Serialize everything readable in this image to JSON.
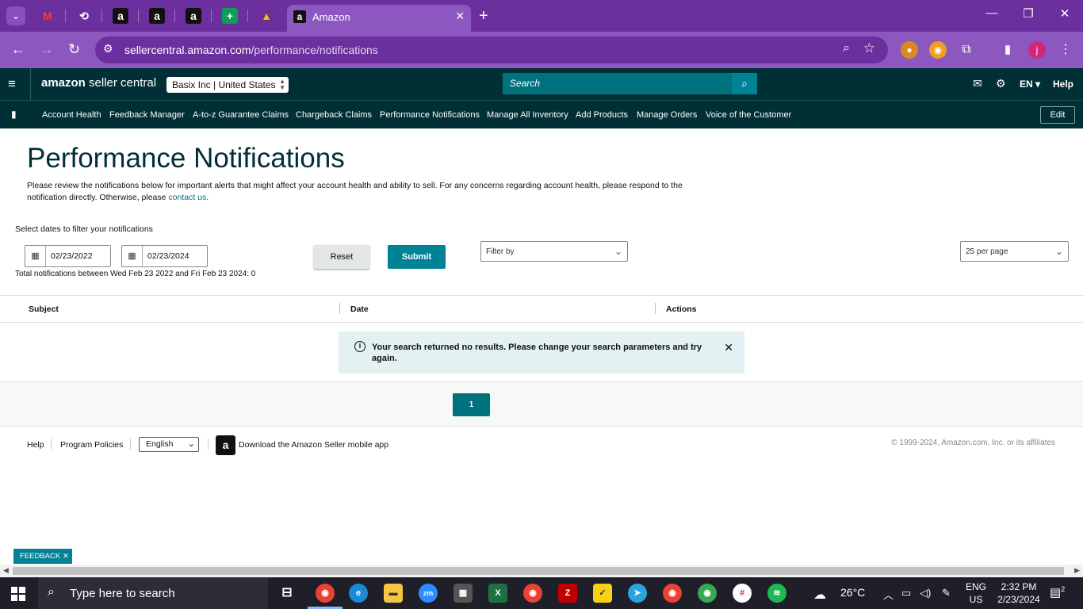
{
  "browser": {
    "active_tab_title": "Amazon",
    "url_host": "sellercentral.amazon.com",
    "url_path": "/performance/notifications",
    "profile_initial": "j"
  },
  "header": {
    "logo_brand": "amazon",
    "logo_suffix": " seller central",
    "account_selector": "Basix Inc | United States",
    "search_placeholder": "Search",
    "language": "EN ▾",
    "help": "Help"
  },
  "nav": {
    "items": [
      "Account Health",
      "Feedback Manager",
      "A-to-z Guarantee Claims",
      "Chargeback Claims",
      "Performance Notifications",
      "Manage All Inventory",
      "Add Products",
      "Manage Orders",
      "Voice of the Customer"
    ],
    "edit_label": "Edit"
  },
  "page": {
    "title": "Performance Notifications",
    "description": "Please review the notifications below for important alerts that might affect your account health and ability to sell. For any concerns regarding account health, please respond to the notification directly. Otherwise, please ",
    "contact_link": "contact us",
    "description_end": ".",
    "filter_label": "Select dates to filter your notifications",
    "start_date": "02/23/2022",
    "end_date": "02/23/2024",
    "reset_label": "Reset",
    "submit_label": "Submit",
    "filter_by_placeholder": "Filter by",
    "per_page": "25 per page",
    "total_text": "Total notifications between Wed Feb 23 2022 and Fri Feb 23 2024: 0"
  },
  "table": {
    "columns": [
      "Subject",
      "Date",
      "Actions"
    ],
    "empty_message": "Your search returned no results. Please change your search parameters and try again."
  },
  "pagination": {
    "current_page": "1"
  },
  "footer": {
    "help": "Help",
    "program_policies": "Program Policies",
    "language": "English",
    "app_download": "Download the Amazon Seller mobile app",
    "copyright": "© 1999-2024, Amazon.com, Inc. or its affiliates"
  },
  "feedback_tab": "FEEDBACK ✕",
  "taskbar": {
    "search_placeholder": "Type here to search",
    "weather": "26°C",
    "language_line1": "ENG",
    "language_line2": "US",
    "time": "2:32 PM",
    "date": "2/23/2024",
    "notification_count": "2"
  }
}
